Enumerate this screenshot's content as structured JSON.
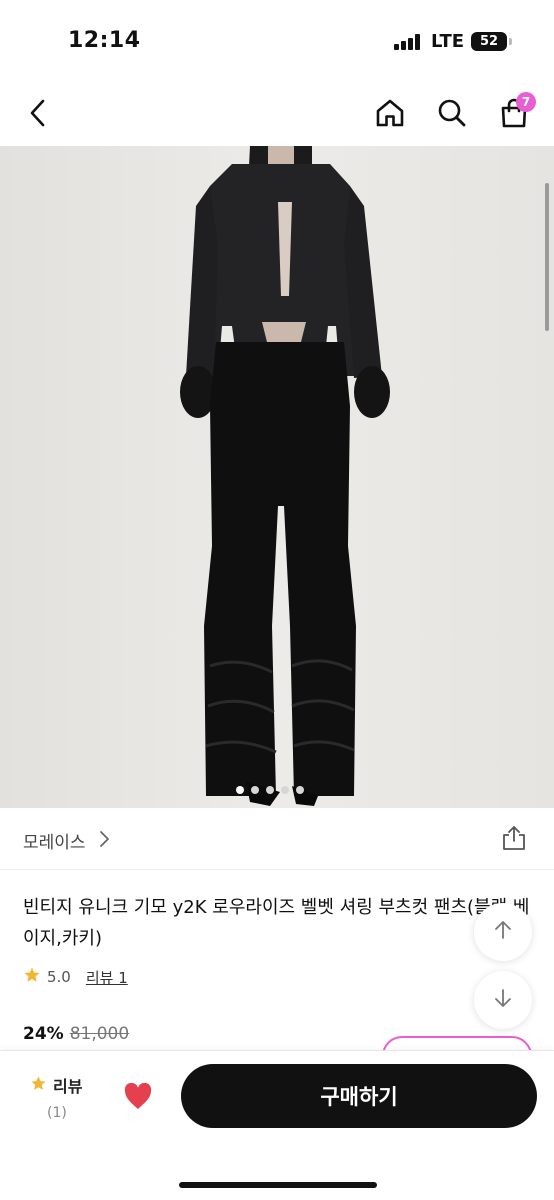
{
  "status_bar": {
    "time": "12:14",
    "network": "LTE",
    "battery": "52"
  },
  "nav": {
    "back_icon": "chevron-left-icon",
    "home_icon": "home-icon",
    "search_icon": "search-icon",
    "cart_icon": "shopping-bag-icon",
    "cart_count": "7",
    "badge_color": "#e85fd3"
  },
  "gallery": {
    "total_images": 5,
    "active_index": 0
  },
  "brand": {
    "name": "모레이스",
    "chevron": ">"
  },
  "product": {
    "title": "빈티지 유니크 기모 y2K 로우라이즈 벨벳 셔링 부츠컷 팬츠(블랙,베이지,카키)",
    "rating": "5.0",
    "review_label": "리뷰 1",
    "discount": "24%",
    "original_price": "81,000"
  },
  "bottom_bar": {
    "review_label": "리뷰",
    "review_count": "(1)",
    "buy_label": "구매하기",
    "buy_button_color": "#111111",
    "heart_color": "#e5404e"
  }
}
